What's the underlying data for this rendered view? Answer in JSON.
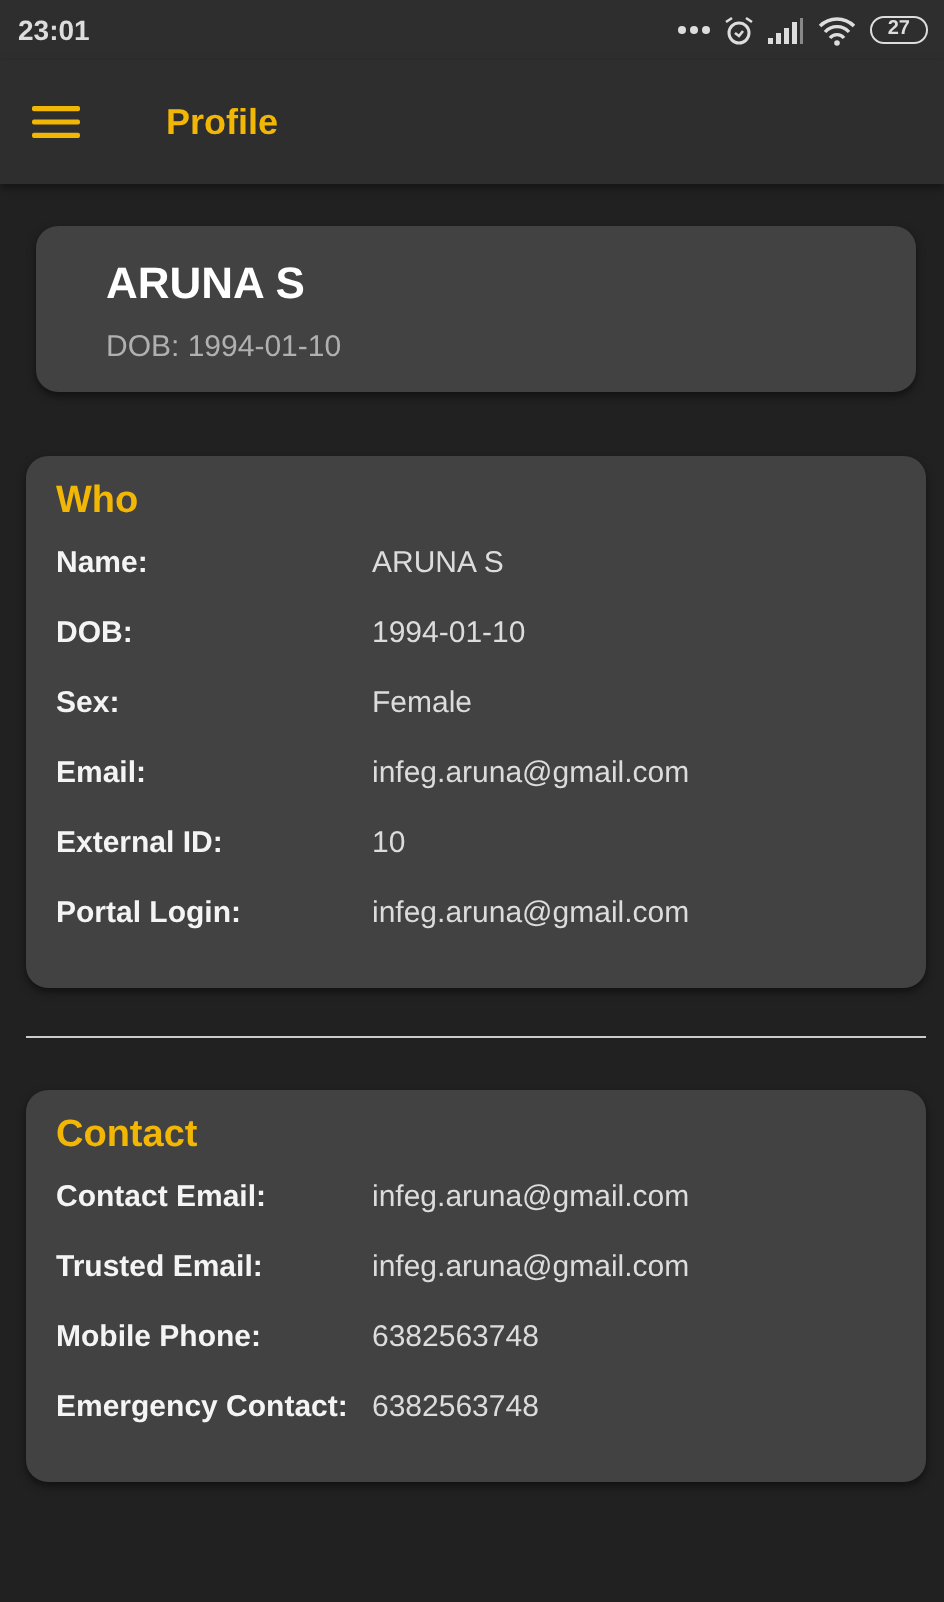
{
  "status_bar": {
    "time": "23:01",
    "battery": "27"
  },
  "app_bar": {
    "title": "Profile"
  },
  "header": {
    "name": "ARUNA S",
    "subtitle": "DOB: 1994-01-10"
  },
  "sections": [
    {
      "title": "Who",
      "rows": [
        {
          "label": "Name:",
          "value": "ARUNA S"
        },
        {
          "label": "DOB:",
          "value": "1994-01-10"
        },
        {
          "label": "Sex:",
          "value": "Female"
        },
        {
          "label": "Email:",
          "value": "infeg.aruna@gmail.com"
        },
        {
          "label": "External ID:",
          "value": "10"
        },
        {
          "label": "Portal Login:",
          "value": "infeg.aruna@gmail.com"
        }
      ]
    },
    {
      "title": "Contact",
      "rows": [
        {
          "label": "Contact Email:",
          "value": "infeg.aruna@gmail.com"
        },
        {
          "label": "Trusted Email:",
          "value": "infeg.aruna@gmail.com"
        },
        {
          "label": "Mobile Phone:",
          "value": "6382563748"
        },
        {
          "label": "Emergency Contact:",
          "value": "6382563748"
        }
      ]
    }
  ]
}
